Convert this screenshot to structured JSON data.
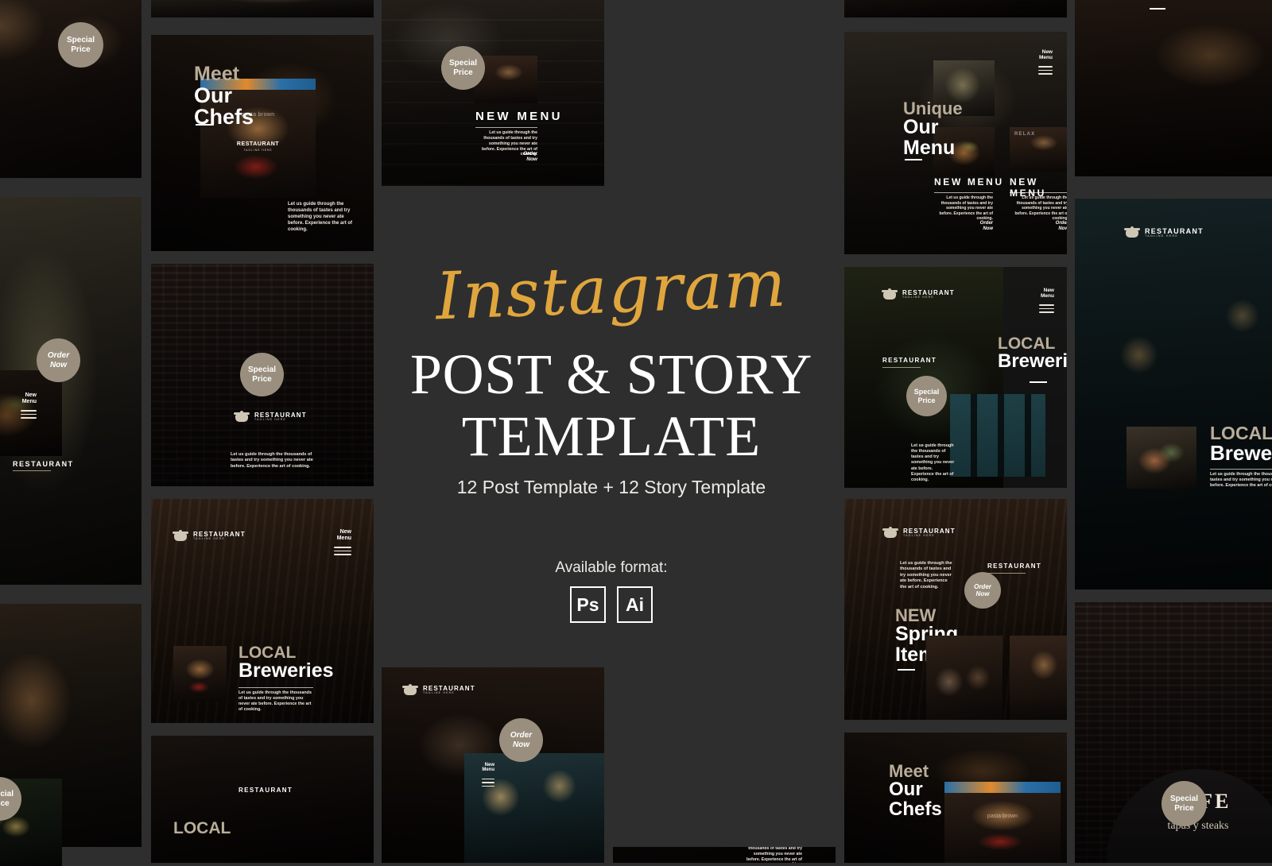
{
  "background_color": "#2e2e2e",
  "accent_color": "#e0a63d",
  "badge_color": "#9a8f7e",
  "hero": {
    "script_title": "Instagram",
    "title_line1": "POST & STORY",
    "title_line2": "TEMPLATE",
    "subtitle": "12 Post Template + 12 Story Template",
    "available_label": "Available format:",
    "formats": [
      {
        "name": "photoshop-format-badge",
        "label": "Ps"
      },
      {
        "name": "illustrator-format-badge",
        "label": "Ai"
      }
    ]
  },
  "common": {
    "logo_name": "RESTAURANT",
    "logo_tagline": "TAGLINE HERE",
    "menu_label_line1": "New",
    "menu_label_line2": "Menu",
    "new_menu": "NEW MENU",
    "order_line1": "Order",
    "order_line2": "Now",
    "special_line1": "Special",
    "special_line2": "Price",
    "restaurant_label": "RESTAURANT",
    "body_text": "Let us guide through the thousands of tastes and try something you never ate before. Experience the art of cooking.",
    "body_text_short": "Let us guide through the thousands of tastes and try something you never ate before. Experience the art of cooking."
  },
  "cards": {
    "meet_chefs": {
      "kicker": "Meet",
      "line1": "Our",
      "line2": "Chefs"
    },
    "new_spring": {
      "kicker": "NEW",
      "line1": "Spring",
      "line2": "Item"
    },
    "unique_menu": {
      "kicker": "Unique",
      "line1": "Our",
      "line2": "Menu"
    },
    "local_breweries": {
      "kicker": "LOCAL",
      "line1": "Breweries"
    },
    "new_menu": {
      "title": "NEW MENU"
    }
  },
  "signage": {
    "restaurant_sign": "RESTAURANT",
    "sign_tagline": "TAGLINE HERE",
    "pasta_sign": "pasta brown",
    "relax_sign": "RELAX",
    "cafe_sign": "CAFE",
    "cafe_sub": "tapas y steaks"
  }
}
